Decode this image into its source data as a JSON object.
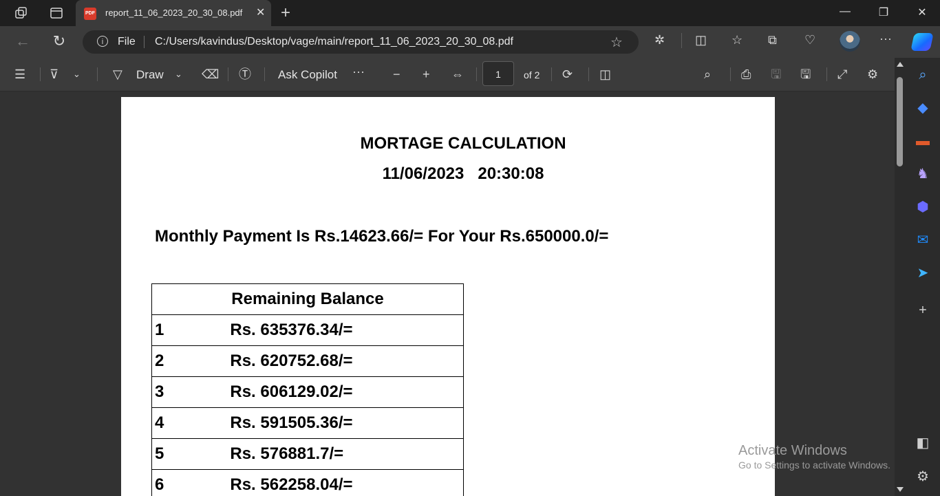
{
  "browser": {
    "tab": {
      "title": "report_11_06_2023_20_30_08.pdf",
      "icon": "pdf-icon",
      "icon_label": "PDF"
    },
    "address": {
      "scheme_label": "File",
      "path": "C:/Users/kavindus/Desktop/vage/main/report_11_06_2023_20_30_08.pdf"
    }
  },
  "pdf_toolbar": {
    "draw_label": "Draw",
    "ask_copilot_label": "Ask Copilot",
    "current_page": "1",
    "page_total": "of 2"
  },
  "document": {
    "title": "MORTAGE CALCULATION",
    "datetime": "11/06/2023   20:30:08",
    "payment_line": "Monthly Payment Is Rs.14623.66/= For Your Rs.650000.0/=",
    "table_header": "Remaining Balance",
    "rows": [
      {
        "n": "1",
        "value": "Rs. 635376.34/="
      },
      {
        "n": "2",
        "value": "Rs. 620752.68/="
      },
      {
        "n": "3",
        "value": "Rs. 606129.02/="
      },
      {
        "n": "4",
        "value": "Rs. 591505.36/="
      },
      {
        "n": "5",
        "value": "Rs. 576881.7/="
      },
      {
        "n": "6",
        "value": "Rs. 562258.04/="
      }
    ]
  },
  "watermark": {
    "line1": "Activate Windows",
    "line2": "Go to Settings to activate Windows."
  },
  "colors": {
    "page_bg": "#323232",
    "toolbar_bg": "#3b3b3b",
    "pdf_badge": "#d93b2b"
  }
}
